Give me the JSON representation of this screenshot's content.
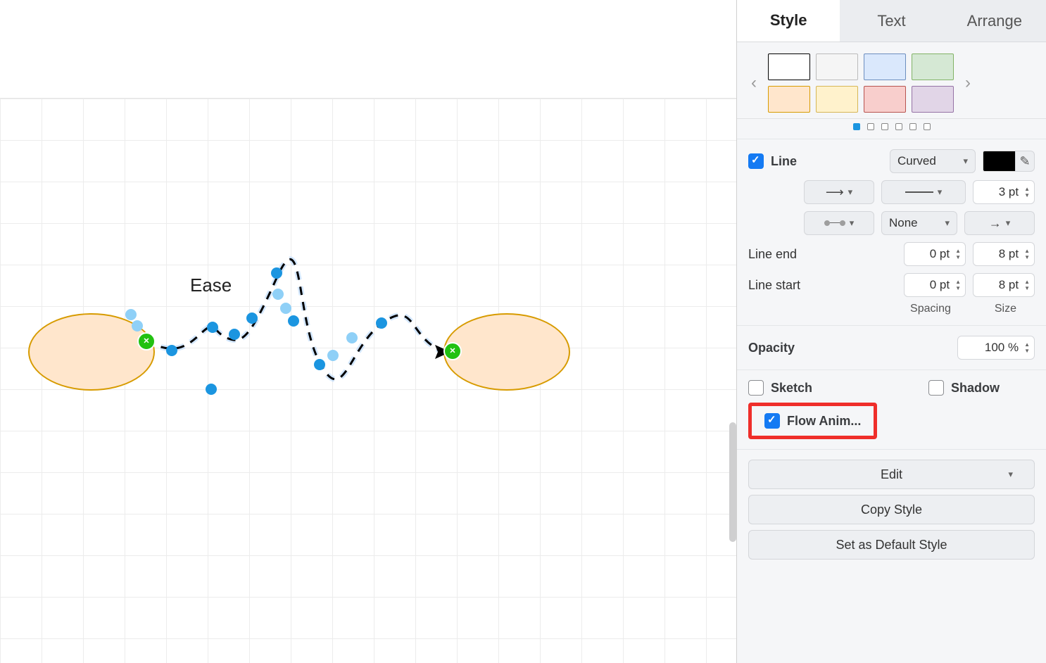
{
  "tabs": {
    "style": "Style",
    "text": "Text",
    "arrange": "Arrange"
  },
  "swatches": {
    "row1": [
      "#ffffff",
      "#f5f5f5",
      "#dae8fc",
      "#d5e8d4"
    ],
    "row2": [
      "#ffe6cc",
      "#fff2cc",
      "#f8cecc",
      "#e1d5e7"
    ],
    "borders": {
      "row1": [
        "#000000",
        "#bbbbbb",
        "#6c8ebf",
        "#82b366"
      ],
      "row2": [
        "#d79b00",
        "#d6b656",
        "#b85450",
        "#9673a6"
      ]
    }
  },
  "line": {
    "checkbox_label": "Line",
    "style": "Curved",
    "width": "3 pt",
    "connection_style": "None",
    "line_end_label": "Line end",
    "line_start_label": "Line start",
    "end_spacing": "0 pt",
    "end_size": "8 pt",
    "start_spacing": "0 pt",
    "start_size": "8 pt",
    "spacing_label": "Spacing",
    "size_label": "Size"
  },
  "opacity": {
    "label": "Opacity",
    "value": "100 %"
  },
  "sketch_label": "Sketch",
  "shadow_label": "Shadow",
  "flowanim_label": "Flow Anim...",
  "buttons": {
    "edit": "Edit",
    "copy": "Copy Style",
    "default": "Set as Default Style"
  },
  "canvas": {
    "edge_label": "Ease"
  }
}
